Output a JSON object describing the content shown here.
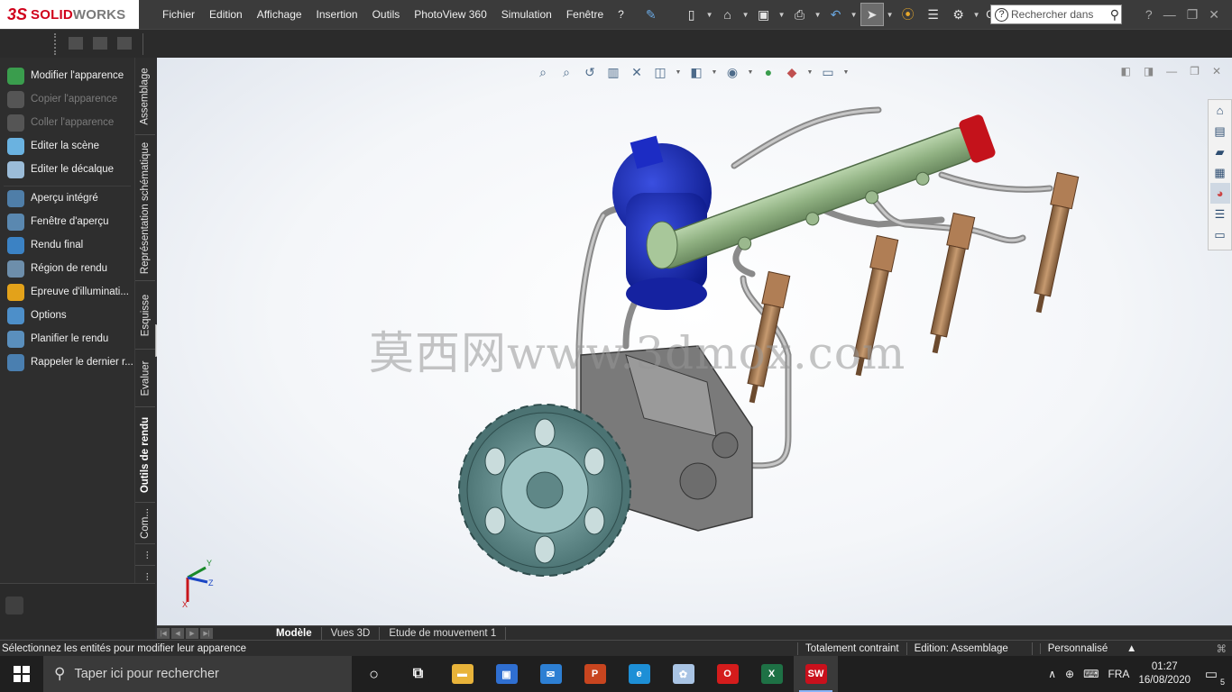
{
  "app": {
    "logo_ds": "3S",
    "logo_solid": "SOLID",
    "logo_works": "WORKS"
  },
  "menu": [
    "Fichier",
    "Edition",
    "Affichage",
    "Insertion",
    "Outils",
    "PhotoView 360",
    "Simulation",
    "Fenêtre",
    "?"
  ],
  "toolbar": {
    "overflow_label": "C...",
    "search_placeholder": "Rechercher dans"
  },
  "commands": [
    {
      "label": "Modifier l'apparence",
      "enabled": true,
      "color": "#3a9d4d"
    },
    {
      "label": "Copier l'apparence",
      "enabled": false,
      "color": "#555555"
    },
    {
      "label": "Coller l'apparence",
      "enabled": false,
      "color": "#555555"
    },
    {
      "label": "Editer la scène",
      "enabled": true,
      "color": "#6ab2e0"
    },
    {
      "label": "Editer le décalque",
      "enabled": true,
      "color": "#9bbcd8"
    },
    {
      "label": "Aperçu intégré",
      "enabled": true,
      "color": "#4f7ea8"
    },
    {
      "label": "Fenêtre d'aperçu",
      "enabled": true,
      "color": "#5a88b0"
    },
    {
      "label": "Rendu final",
      "enabled": true,
      "color": "#3b82c4"
    },
    {
      "label": "Région de rendu",
      "enabled": true,
      "color": "#6d8eab"
    },
    {
      "label": "Epreuve d'illuminati...",
      "enabled": true,
      "color": "#e3a21a"
    },
    {
      "label": "Options",
      "enabled": true,
      "color": "#4d8fc9"
    },
    {
      "label": "Planifier le rendu",
      "enabled": true,
      "color": "#5a8fbd"
    },
    {
      "label": "Rappeler le dernier r...",
      "enabled": true,
      "color": "#4a7fb0"
    }
  ],
  "vertical_tabs": [
    "Assemblage",
    "Représentation schématique",
    "Esquisse",
    "Evaluer",
    "Outils de rendu",
    "Com...",
    "...",
    "..."
  ],
  "active_vertical_tab": "Outils de rendu",
  "watermark": "莫西网www.3dmox.com",
  "triad_labels": {
    "x": "X",
    "y": "Y",
    "z": "Z"
  },
  "bottom_tabs": [
    "Modèle",
    "Vues 3D",
    "Etude de mouvement 1"
  ],
  "active_bottom_tab": "Modèle",
  "status": {
    "message": "Sélectionnez les entités pour modifier leur apparence",
    "constraint": "Totalement contraint",
    "edition": "Edition: Assemblage",
    "units": "Personnalisé"
  },
  "taskbar": {
    "search_placeholder": "Taper ici pour rechercher",
    "apps": [
      {
        "name": "task-view",
        "label": "",
        "color": "#1f1f1f"
      },
      {
        "name": "file-explorer",
        "label": "",
        "color": "#e8b33a"
      },
      {
        "name": "store",
        "label": "",
        "color": "#2f6fd1"
      },
      {
        "name": "mail",
        "label": "",
        "color": "#2d7fd3"
      },
      {
        "name": "powerpoint",
        "label": "P",
        "color": "#c8451f"
      },
      {
        "name": "edge",
        "label": "",
        "color": "#1d8fd6"
      },
      {
        "name": "paint",
        "label": "",
        "color": "#a9c4e4"
      },
      {
        "name": "opera",
        "label": "O",
        "color": "#d41c1c"
      },
      {
        "name": "excel",
        "label": "X",
        "color": "#1e7145"
      },
      {
        "name": "solidworks",
        "label": "SW",
        "color": "#c9101c"
      }
    ],
    "language": "FRA",
    "time": "01:27",
    "date": "16/08/2020",
    "notifications": "5"
  }
}
